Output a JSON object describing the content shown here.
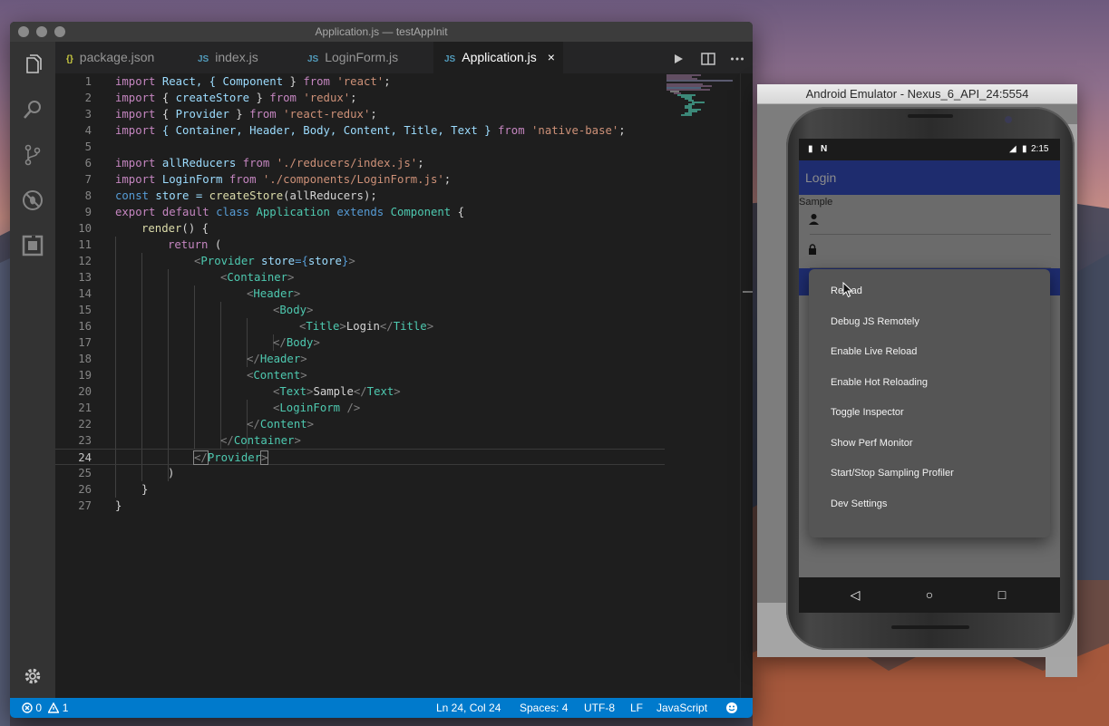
{
  "vscode": {
    "window_title": "Application.js — testAppInit",
    "tabs": [
      {
        "icon": "{}",
        "label": "package.json"
      },
      {
        "icon": "JS",
        "label": "index.js"
      },
      {
        "icon": "JS",
        "label": "LoginForm.js"
      },
      {
        "icon": "JS",
        "label": "Application.js",
        "close": "×"
      }
    ],
    "line_numbers": [
      "1",
      "2",
      "3",
      "4",
      "5",
      "6",
      "7",
      "8",
      "9",
      "10",
      "11",
      "12",
      "13",
      "14",
      "15",
      "16",
      "17",
      "18",
      "19",
      "20",
      "21",
      "22",
      "23",
      "24",
      "25",
      "26",
      "27"
    ],
    "code": {
      "l1": [
        "import",
        " React, { ",
        "Component",
        " } ",
        "from",
        " ",
        "'react'",
        ";"
      ],
      "l2": [
        "import",
        " { ",
        "createStore",
        " } ",
        "from",
        " ",
        "'redux'",
        ";"
      ],
      "l3": [
        "import",
        " { ",
        "Provider",
        " } ",
        "from",
        " ",
        "'react-redux'",
        ";"
      ],
      "l4": [
        "import",
        " { Container, Header, Body, Content, Title, Text } ",
        "from",
        " ",
        "'native-base'",
        ";"
      ],
      "l6": [
        "import",
        " allReducers ",
        "from",
        " ",
        "'./reducers/index.js'",
        ";"
      ],
      "l7": [
        "import",
        " LoginForm ",
        "from",
        " ",
        "'./components/LoginForm.js'",
        ";"
      ],
      "l8": [
        "const",
        " store = ",
        "createStore",
        "(allReducers);"
      ],
      "l9": [
        "export",
        " ",
        "default",
        " ",
        "class",
        " ",
        "Application",
        " ",
        "extends",
        " ",
        "Component",
        " {"
      ],
      "l10": [
        "render",
        "() {"
      ],
      "l11": [
        "return",
        " ("
      ],
      "l12": [
        "<",
        "Provider",
        " store",
        "={",
        "store",
        "}",
        ">"
      ],
      "l13": [
        "<",
        "Container",
        ">"
      ],
      "l14": [
        "<",
        "Header",
        ">"
      ],
      "l15": [
        "<",
        "Body",
        ">"
      ],
      "l16": [
        "<",
        "Title",
        ">",
        "Login",
        "</",
        "Title",
        ">"
      ],
      "l17": [
        "</",
        "Body",
        ">"
      ],
      "l18": [
        "</",
        "Header",
        ">"
      ],
      "l19": [
        "<",
        "Content",
        ">"
      ],
      "l20": [
        "<",
        "Text",
        ">",
        "Sample",
        "</",
        "Text",
        ">"
      ],
      "l21": [
        "<",
        "LoginForm",
        " />"
      ],
      "l22": [
        "</",
        "Content",
        ">"
      ],
      "l23": [
        "</",
        "Container",
        ">"
      ],
      "l24": [
        "</",
        "Provider",
        ">"
      ],
      "l25": [
        ")"
      ],
      "l26": [
        "}"
      ],
      "l27": [
        "}"
      ]
    },
    "status": {
      "errors": "0",
      "warnings": "1",
      "position": "Ln 24, Col 24",
      "spaces": "Spaces: 4",
      "encoding": "UTF-8",
      "eol": "LF",
      "language": "JavaScript"
    },
    "icons": {
      "activity": [
        "files-icon",
        "search-icon",
        "source-control-icon",
        "debug-icon",
        "extensions-icon"
      ],
      "settings": "gear-icon",
      "actions": [
        "run-icon",
        "split-editor-icon",
        "more-icon"
      ]
    },
    "colors": {
      "statusbar": "#007acc",
      "editor_bg": "#1e1e1e"
    }
  },
  "emulator": {
    "window_title": "Android Emulator - Nexus_6_API_24:5554",
    "time": "2:15",
    "app_title": "Login",
    "sample_text": "Sample",
    "dev_menu": [
      "Reload",
      "Debug JS Remotely",
      "Enable Live Reload",
      "Enable Hot Reloading",
      "Toggle Inspector",
      "Show Perf Monitor",
      "Start/Stop Sampling Profiler",
      "Dev Settings"
    ],
    "nav": {
      "back": "◁",
      "home": "○",
      "recents": "□"
    }
  }
}
